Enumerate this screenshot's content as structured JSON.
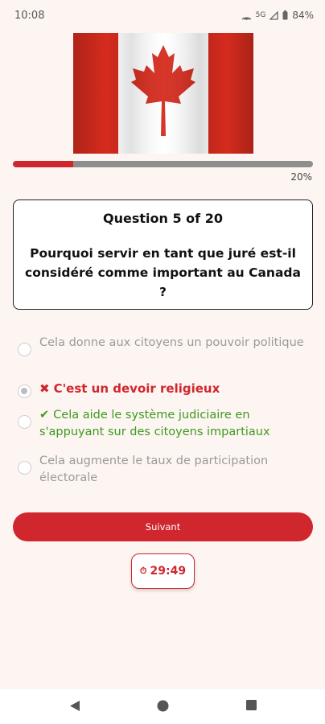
{
  "status_bar": {
    "time": "10:08",
    "network": "5G",
    "battery": "84%"
  },
  "flag": {
    "name": "Canada",
    "red": "#d52b1e",
    "white": "#ffffff"
  },
  "progress": {
    "fraction": 0.2,
    "label": "20%"
  },
  "question": {
    "number_label": "Question 5 of 20",
    "text": "Pourquoi servir en tant que juré est-il considéré comme important au Canada ?"
  },
  "options": [
    {
      "text": "Cela donne aux citoyens un pouvoir politique",
      "state": "neutral"
    },
    {
      "mark": "✖",
      "text": "C'est un devoir religieux",
      "state": "wrong-selected"
    },
    {
      "mark": "✔",
      "text": "Cela aide le système judiciaire en s'appuyant sur des citoyens impartiaux",
      "state": "correct"
    },
    {
      "text": "Cela augmente le taux de participation électorale",
      "state": "neutral"
    }
  ],
  "next_button": {
    "label": "Suivant"
  },
  "timer": {
    "icon": "⏱",
    "value": "29:49"
  },
  "colors": {
    "accent": "#d0262e",
    "correct": "#3d9a1f",
    "muted": "#9a9a9a",
    "background": "#fdf5f1"
  },
  "nav": {
    "back_icon": "back-triangle-icon",
    "home_icon": "home-circle-icon",
    "recents_icon": "recents-square-icon"
  }
}
